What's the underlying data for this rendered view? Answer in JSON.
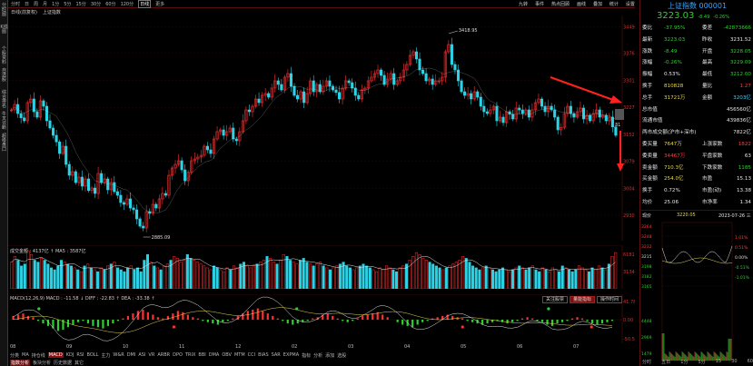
{
  "left_tabs": [
    {
      "label": "分时图"
    },
    {
      "label": "K线图"
    },
    {
      "label": "个股资料"
    },
    {
      "label": "自选股"
    },
    {
      "label": "综合排名"
    },
    {
      "label": "牛叉诊断"
    },
    {
      "label": "超级盘口"
    }
  ],
  "toolbar": {
    "items": [
      {
        "label": "分时",
        "on": false
      },
      {
        "label": "日",
        "on": false
      },
      {
        "label": "周",
        "on": false
      },
      {
        "label": "月",
        "on": false
      },
      {
        "label": "1分",
        "on": false
      },
      {
        "label": "5分",
        "on": false
      },
      {
        "label": "15分",
        "on": false
      },
      {
        "label": "30分",
        "on": false
      },
      {
        "label": "60分",
        "on": false
      },
      {
        "label": "120分",
        "on": false
      },
      {
        "label": "日线",
        "on": true
      },
      {
        "label": "更多",
        "on": false
      }
    ],
    "right": [
      {
        "label": "九转"
      },
      {
        "label": "事件"
      },
      {
        "label": "热点回顾"
      },
      {
        "label": "画线"
      },
      {
        "label": "叠加"
      },
      {
        "label": "统计"
      },
      {
        "label": "设置"
      }
    ]
  },
  "title_row": {
    "items": [
      "日线(前复权)",
      "上证指数"
    ]
  },
  "main_chart": {
    "y_ticks": [
      "3449",
      "3376",
      "3301",
      "3227",
      "3152",
      "3079",
      "3004",
      "2930"
    ],
    "x_ticks": [
      "08",
      "09",
      "10",
      "11",
      "12",
      "02",
      "03",
      "04",
      "05",
      "06",
      "07"
    ],
    "high_label": "3418.95",
    "low_label": "2885.09",
    "side_label": "31",
    "colors": {
      "up": "#ff3030",
      "down": "#2bd3e6",
      "arrow": "#ff2020",
      "ma": "#e8e8e8"
    },
    "candles": [
      3220,
      3235,
      3210,
      3198,
      3190,
      3240,
      3250,
      3215,
      3200,
      3245,
      3230,
      3190,
      3170,
      3150,
      3132,
      3100,
      3120,
      3070,
      3040,
      3050,
      3020,
      3035,
      3010,
      3030,
      2998,
      3005,
      2990,
      3045,
      3020,
      3030,
      3000,
      3020,
      2995,
      2985,
      2965,
      2960,
      2975,
      2950,
      2945,
      2920,
      2900,
      2895,
      2940,
      2935,
      2960,
      2950,
      2975,
      2990,
      2985,
      3040,
      3060,
      3070,
      3080,
      3055,
      3025,
      3048,
      3080,
      3085,
      3090,
      3095,
      3120,
      3110,
      3100,
      3140,
      3160,
      3165,
      3150,
      3160,
      3170,
      3140,
      3135,
      3160,
      3190,
      3220,
      3215,
      3230,
      3250,
      3240,
      3260,
      3265,
      3255,
      3280,
      3300,
      3290,
      3275,
      3310,
      3320,
      3285,
      3260,
      3250,
      3270,
      3240,
      3265,
      3300,
      3270,
      3290,
      3270,
      3285,
      3300,
      3285,
      3275,
      3268,
      3250,
      3280,
      3300,
      3295,
      3280,
      3260,
      3250,
      3275,
      3280,
      3300,
      3310,
      3320,
      3330,
      3315,
      3290,
      3305,
      3320,
      3290,
      3300,
      3310,
      3330,
      3345,
      3370,
      3380,
      3360,
      3330,
      3320,
      3300,
      3305,
      3290,
      3300,
      3300,
      3310,
      3380,
      3400,
      3345,
      3330,
      3300,
      3270,
      3260,
      3265,
      3250,
      3270,
      3255,
      3230,
      3215,
      3210,
      3220,
      3230,
      3190,
      3200,
      3185,
      3215,
      3208,
      3195,
      3225,
      3220,
      3210,
      3220,
      3200,
      3220,
      3240,
      3250,
      3230,
      3215,
      3230,
      3220,
      3200,
      3165,
      3172,
      3210,
      3230,
      3210,
      3200,
      3215,
      3225,
      3195,
      3205,
      3190,
      3210,
      3220,
      3200,
      3205,
      3190,
      3200,
      3173,
      3150
    ]
  },
  "volume": {
    "label": "成交金额 : 4137亿 ↑ MA5 : 3587亿",
    "y_top": "6181",
    "y_mid": "3134",
    "bars": [
      28,
      34,
      30,
      24,
      26,
      40,
      36,
      30,
      28,
      32,
      30,
      26,
      22,
      20,
      24,
      30,
      28,
      26,
      24,
      22,
      20,
      18,
      24,
      26,
      22,
      20,
      18,
      22,
      20,
      24,
      26,
      28,
      22,
      20,
      18,
      22,
      24,
      20,
      22,
      18,
      30,
      36,
      28,
      24,
      22,
      20,
      24,
      26,
      30,
      34,
      32,
      28,
      30,
      36,
      32,
      30,
      28,
      26,
      24,
      22,
      20,
      24,
      22,
      20,
      18,
      22,
      20,
      24,
      22,
      26,
      28,
      24,
      22,
      24,
      26,
      28,
      30,
      34,
      32,
      28,
      26,
      30,
      36,
      34,
      30,
      28,
      26,
      30,
      32,
      28,
      26,
      24,
      26,
      28,
      24,
      22,
      20,
      22,
      24,
      26,
      28,
      24,
      22,
      20,
      22,
      24,
      26,
      24,
      22,
      20,
      18,
      22,
      20,
      24,
      22,
      20,
      18,
      22,
      24,
      26,
      30,
      34,
      38,
      36,
      32,
      30,
      28,
      26,
      24,
      22,
      20,
      22,
      24,
      26,
      28,
      30,
      34,
      32,
      28,
      24,
      22,
      20,
      22,
      24,
      22,
      20,
      18,
      20,
      22,
      20,
      18,
      20,
      22,
      24,
      22,
      20,
      22,
      24,
      20,
      18,
      22,
      20,
      18,
      22,
      20,
      18,
      24,
      22,
      20,
      18,
      20,
      24,
      22,
      20,
      18,
      22,
      20,
      24,
      22,
      20,
      26,
      34,
      38
    ]
  },
  "macd": {
    "label": "MACD(12,26,9)  MACD : -11.58 ↓ DIFF : -22.83 ↑ DEA : -33.38 ↑",
    "y_top": "41.78",
    "y_zero": "0.00",
    "y_bot": "-50.55",
    "hist": [
      6,
      8,
      10,
      6,
      4,
      -2,
      -6,
      -10,
      -14,
      -18,
      -16,
      -12,
      -8,
      -4,
      -2,
      -6,
      -10,
      -12,
      -14,
      -10,
      -6,
      -2,
      2,
      6,
      10,
      14,
      16,
      12,
      8,
      4,
      2,
      6,
      10,
      14,
      12,
      8,
      4,
      2,
      -2,
      -4,
      -6,
      -8,
      -4,
      -2,
      2,
      6,
      10,
      14,
      16,
      18,
      14,
      10,
      6,
      2,
      -2,
      -6,
      -8,
      -6,
      -4,
      -2,
      2,
      4,
      8,
      10,
      6,
      2,
      -2,
      -4,
      -2,
      2,
      6,
      8,
      10,
      12,
      8,
      4,
      0,
      -4,
      -8,
      -10,
      -12,
      -8,
      -4,
      -2,
      2,
      4,
      6,
      8,
      6,
      4,
      2,
      -2,
      -4,
      -6,
      -8,
      -6,
      -4,
      -2,
      -4,
      -6,
      -4,
      -2,
      2,
      4,
      2,
      -2,
      -4,
      -8,
      -10,
      -6,
      -4,
      -2,
      2,
      4,
      2,
      -2,
      -6,
      -8,
      -6,
      -4,
      -2
    ]
  },
  "indicator_buttons": [
    {
      "label": "关注股票",
      "on": false
    },
    {
      "label": "量能指标",
      "on": true
    },
    {
      "label": "操作时间",
      "on": false
    }
  ],
  "bottom_tabs": [
    {
      "label": "分类",
      "on": false
    },
    {
      "label": "MA",
      "on": false
    },
    {
      "label": "持仓线",
      "on": false
    },
    {
      "label": "MACD",
      "on": true
    },
    {
      "label": "KDJ",
      "on": false
    },
    {
      "label": "RSI",
      "on": false
    },
    {
      "label": "BOLL",
      "on": false
    },
    {
      "label": "主力",
      "on": false
    },
    {
      "label": "W&R",
      "on": false
    },
    {
      "label": "DMI",
      "on": false
    },
    {
      "label": "ASI",
      "on": false
    },
    {
      "label": "VR",
      "on": false
    },
    {
      "label": "ARBR",
      "on": false
    },
    {
      "label": "DPO",
      "on": false
    },
    {
      "label": "TRIX",
      "on": false
    },
    {
      "label": "BBI",
      "on": false
    },
    {
      "label": "DMA",
      "on": false
    },
    {
      "label": "OBV",
      "on": false
    },
    {
      "label": "MTM",
      "on": false
    },
    {
      "label": "CCI",
      "on": false
    },
    {
      "label": "BIAS",
      "on": false
    },
    {
      "label": "SAR",
      "on": false
    },
    {
      "label": "EXPMA",
      "on": false
    },
    {
      "label": "指标",
      "on": false
    },
    {
      "label": "分析",
      "on": false
    },
    {
      "label": "添加",
      "on": false
    },
    {
      "label": "选股",
      "on": false
    }
  ],
  "bottom_tabs2": [
    {
      "label": "指数分析",
      "on": true
    },
    {
      "label": "板块分析",
      "on": false
    },
    {
      "label": "历史数据",
      "on": false
    },
    {
      "label": "其它",
      "on": false
    }
  ],
  "right_panel": {
    "title": "上证指数 000001",
    "price": "3223.03",
    "change": "-8.49",
    "pct": "-0.26%",
    "rows": [
      {
        "k1": "委比",
        "v1": "-37.95%",
        "c1": "g",
        "k2": "委差",
        "v2": "-42873666",
        "c2": "g"
      },
      {
        "k1": "最新",
        "v1": "3223.03",
        "c1": "g",
        "k2": "昨收",
        "v2": "3231.52",
        "c2": "w"
      },
      {
        "k1": "涨跌",
        "v1": "-8.49",
        "c1": "g",
        "k2": "开盘",
        "v2": "3228.05",
        "c2": "g"
      },
      {
        "k1": "涨幅",
        "v1": "-0.26%",
        "c1": "g",
        "k2": "最高",
        "v2": "3229.09",
        "c2": "g"
      },
      {
        "k1": "振幅",
        "v1": "0.53%",
        "c1": "w",
        "k2": "最低",
        "v2": "3212.00",
        "c2": "g"
      },
      {
        "k1": "换手",
        "v1": "810828",
        "c1": "y",
        "k2": "量比",
        "v2": "1.27",
        "c2": "r"
      },
      {
        "k1": "总手",
        "v1": "31721万",
        "c1": "y",
        "k2": "金额",
        "v2": "3203亿",
        "c2": "c"
      },
      {
        "k1": "总市值",
        "v1": "",
        "c1": "w",
        "k2": "",
        "v2": "456560亿",
        "c2": "w"
      },
      {
        "k1": "流通市值",
        "v1": "",
        "c1": "w",
        "k2": "",
        "v2": "439836亿",
        "c2": "w"
      },
      {
        "k1": "两市成交额(沪市+深市)",
        "v1": "",
        "c1": "w",
        "k2": "",
        "v2": "7822亿",
        "c2": "w"
      },
      {
        "k1": "委买量",
        "v1": "7647万",
        "c1": "y",
        "k2": "上涨家数",
        "v2": "1822",
        "c2": "r"
      },
      {
        "k1": "委卖量",
        "v1": "34467万",
        "c1": "r",
        "k2": "平盘家数",
        "v2": "63",
        "c2": "w"
      },
      {
        "k1": "卖金额",
        "v1": "710.3亿",
        "c1": "y",
        "k2": "下跌家数",
        "v2": "1185",
        "c2": "g"
      },
      {
        "k1": "买金额",
        "v1": "254.0亿",
        "c1": "y",
        "k2": "市盈",
        "v2": "15.13",
        "c2": "w"
      },
      {
        "k1": "换手",
        "v1": "0.72%",
        "c1": "w",
        "k2": "市盈(动)",
        "v2": "13.38",
        "c2": "w"
      },
      {
        "k1": "均价",
        "v1": "25.06",
        "c1": "w",
        "k2": "市净率",
        "v2": "1.34",
        "c2": "w"
      }
    ],
    "now_label": "现价",
    "now_value": "3220.05",
    "date": "2023-07-26 三",
    "mini_y": [
      "3264",
      "3248",
      "3232",
      "3215",
      "3198",
      "3182",
      "3165",
      "4448",
      "2969",
      "1479"
    ],
    "mini_pct": [
      "1.01%",
      "0.51%",
      "0.00%",
      "-0.51%",
      "-1.01%"
    ],
    "mini_tabs": [
      {
        "label": "分时"
      },
      {
        "label": "五日"
      },
      {
        "label": "1分"
      },
      {
        "label": "5分"
      },
      {
        "label": "15"
      },
      {
        "label": "30"
      },
      {
        "label": "60"
      }
    ]
  }
}
